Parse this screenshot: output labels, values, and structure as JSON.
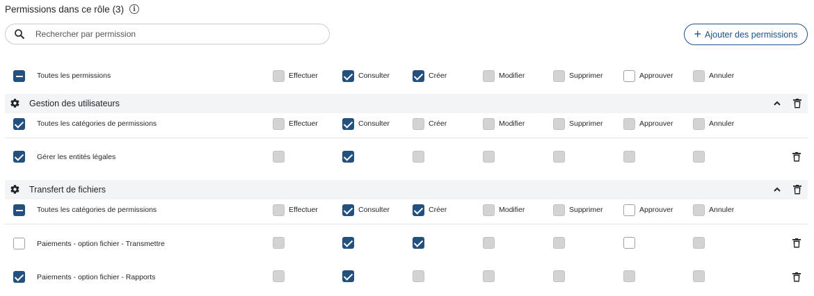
{
  "header": {
    "title": "Permissions dans ce rôle (3)"
  },
  "search": {
    "placeholder": "Rechercher par permission"
  },
  "add_button": {
    "label": "Ajouter des permissions"
  },
  "columns": [
    "Effectuer",
    "Consulter",
    "Créer",
    "Modifier",
    "Supprimer",
    "Approuver",
    "Annuler"
  ],
  "top_row": {
    "label": "Toutes les permissions"
  },
  "sections": [
    {
      "title": "Gestion des utilisateurs",
      "all_label": "Toutes les catégories de permissions",
      "rows": [
        {
          "label": "Gérer les entités légales"
        }
      ]
    },
    {
      "title": "Transfert de fichiers",
      "all_label": "Toutes les catégories de permissions",
      "rows": [
        {
          "label": "Paiements - option fichier - Transmettre"
        },
        {
          "label": "Paiements - option fichier - Rapports"
        }
      ]
    }
  ],
  "colors": {
    "accent": "#22507f",
    "disabled": "#d3d3d3",
    "section_bg": "#f3f4f6"
  }
}
